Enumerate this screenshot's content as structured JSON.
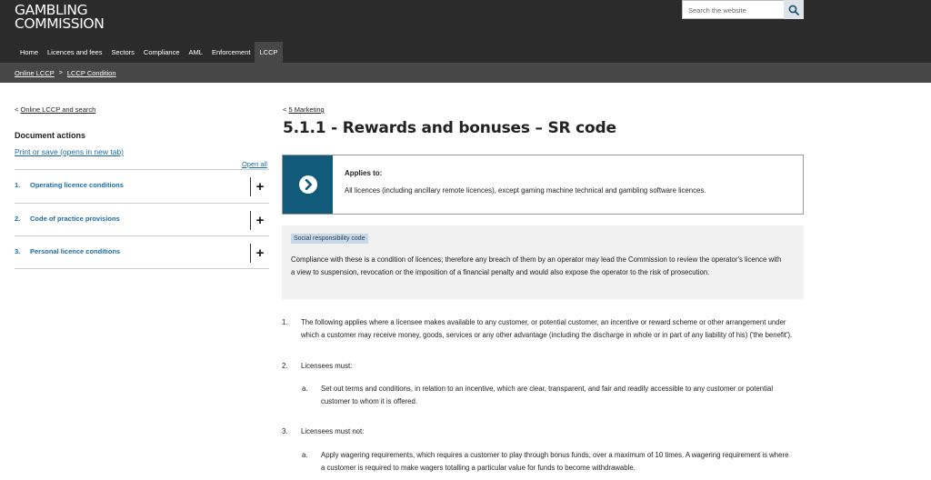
{
  "header": {
    "logo_line1": "GAMBLING",
    "logo_line2": "COMMISSION",
    "search_placeholder": "Search the website",
    "search_icon": "search-icon"
  },
  "nav": {
    "items": [
      "Home",
      "Licences and fees",
      "Sectors",
      "Compliance",
      "AML",
      "Enforcement",
      "LCCP"
    ],
    "active": "LCCP"
  },
  "breadcrumb": {
    "items": [
      "Online LCCP",
      "LCCP Condition"
    ],
    "separator": ">"
  },
  "sidebar": {
    "back_arrow": "<",
    "back_link": "Online LCCP and search",
    "document_actions_heading": "Document actions",
    "print_link": "Print or save (opens in new tab)",
    "open_all": "Open all",
    "accordion": [
      {
        "number": "1.",
        "label": "Operating licence conditions",
        "toggle": "+"
      },
      {
        "number": "2.",
        "label": "Code of practice provisions",
        "toggle": "+"
      },
      {
        "number": "3.",
        "label": "Personal licence conditions",
        "toggle": "+"
      }
    ]
  },
  "main": {
    "up_arrow": "<",
    "up_link": "5 Marketing",
    "title": "5.1.1 - Rewards and bonuses – SR code",
    "applies": {
      "icon": "arrow-right-circle-icon",
      "heading": "Applies to:",
      "text": "All licences (including ancillary remote licences), except gaming machine technical and gambling software licences."
    },
    "sr_box": {
      "badge": "Social responsibility code",
      "text": "Compliance with these is a condition of licences; therefore any breach of them by an operator may lead the Commission to review the operator's licence with a view to suspension, revocation or the imposition of a financial penalty and would also expose the operator to the risk of prosecution."
    },
    "provisions": [
      {
        "number": "1.",
        "text": "The following applies where a licensee makes available to any customer, or potential customer, an incentive or reward scheme or other arrangement under which a customer may receive money, goods, services or any other advantage (including the discharge in whole or in part of any liability of his) ('the benefit')."
      },
      {
        "number": "2.",
        "text": "Licensees must:"
      },
      {
        "number": "3.",
        "text": "Licensees must not:"
      }
    ],
    "sub_items": [
      {
        "number": "a.",
        "text": "Set out terms and conditions, in relation to an incentive, which are clear, transparent, and fair and readily accessible to any customer or potential customer to whom it is offered."
      },
      {
        "number": "a.",
        "text": "Apply wagering requirements, which requires a customer to play through bonus funds, over a maximum of 10 times. A wagering requirement is where a customer is required to make wagers totalling a particular value for funds to become withdrawable."
      }
    ]
  },
  "colors": {
    "header_bg": "#2b2b2b",
    "breadcrumb_bg": "#474747",
    "link_blue": "#1b6aa5",
    "applies_icon_bg": "#125a79",
    "sr_box_bg": "#f1f1f1",
    "sr_badge_bg": "#c8d8e6"
  }
}
